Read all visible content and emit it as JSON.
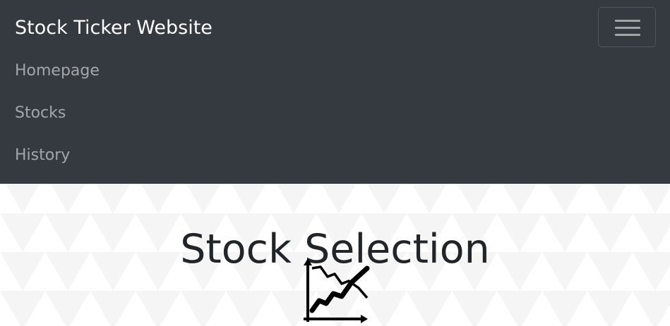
{
  "navbar": {
    "brand": "Stock Ticker Website",
    "links": [
      {
        "label": "Homepage"
      },
      {
        "label": "Stocks"
      },
      {
        "label": "History"
      }
    ],
    "background": "#343a40"
  },
  "main": {
    "title": "Stock Selection",
    "icon": "line-chart-icon"
  }
}
